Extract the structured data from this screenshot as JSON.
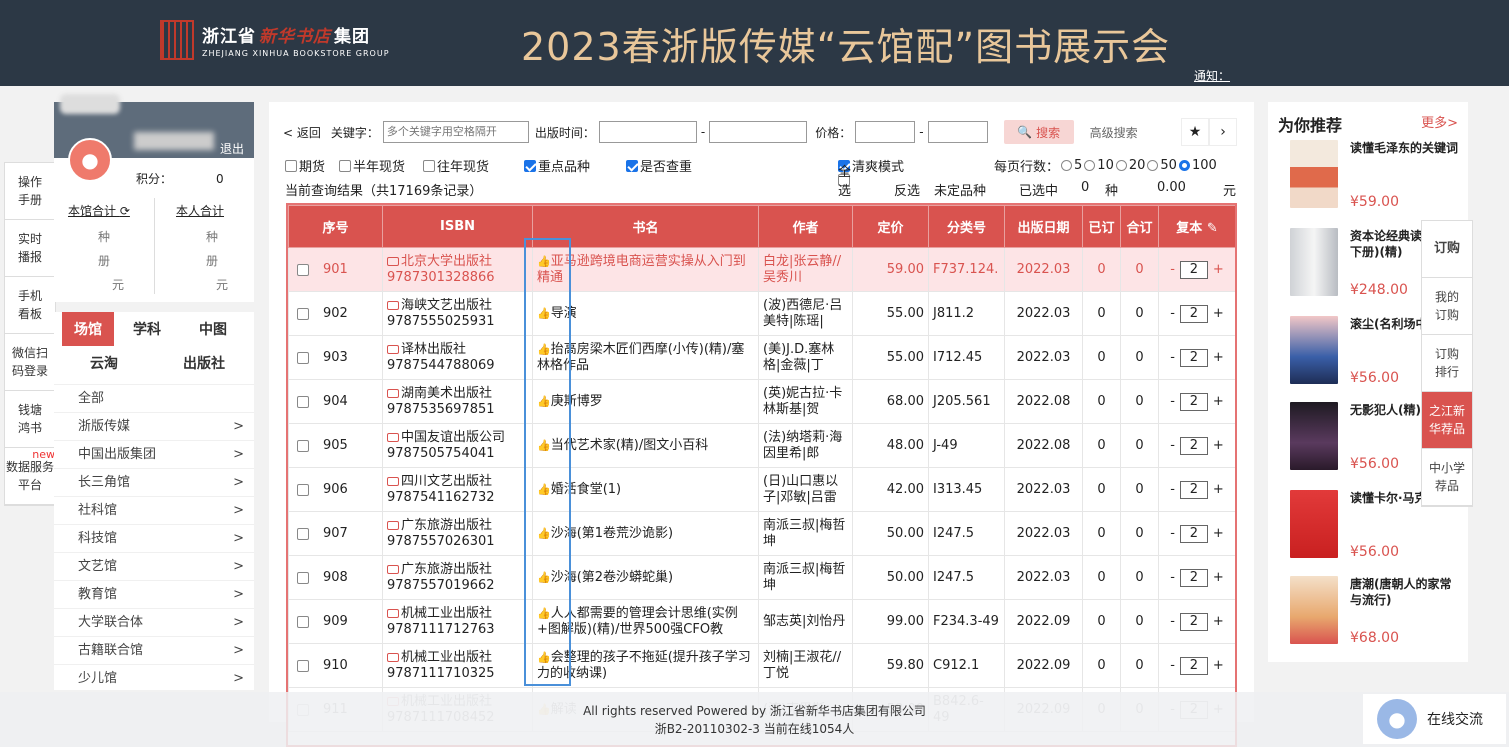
{
  "header": {
    "logo_cn_a": "浙江省",
    "logo_cn_b": "新华书店",
    "logo_cn_c": "集团",
    "logo_en": "ZHEJIANG XINHUA BOOKSTORE GROUP",
    "title": "2023春浙版传媒“云馆配”图书展示会",
    "notice": "通知："
  },
  "user": {
    "logout": "退出",
    "points_label": "积分：",
    "points_value": "0",
    "lib_total": "本馆合计",
    "my_total": "本人合计",
    "unit_kind": "种",
    "unit_book": "册",
    "unit_yuan": "元"
  },
  "sidetabs": [
    {
      "label": "操作手册"
    },
    {
      "label": "实时播报"
    },
    {
      "label": "手机看板"
    },
    {
      "label": "微信扫码登录"
    },
    {
      "label": "钱塘鸿书"
    },
    {
      "label": "数据服务平台",
      "badge": "new"
    }
  ],
  "cat": {
    "tabs": [
      "场馆",
      "学科",
      "中图",
      "云淘",
      "出版社"
    ],
    "items": [
      "全部",
      "浙版传媒",
      "中国出版集团",
      "长三角馆",
      "社科馆",
      "科技馆",
      "文艺馆",
      "教育馆",
      "大学联合体",
      "古籍联合馆",
      "少儿馆"
    ]
  },
  "filters": {
    "back": "< 返回",
    "keyword_label": "关键字：",
    "keyword_placeholder": "多个关键字用空格隔开",
    "date_label": "出版时间：",
    "dash": "-",
    "price_label": "价格：",
    "search": "搜索",
    "advanced": "高级搜索",
    "opts": [
      "期货",
      "半年现货",
      "往年现货",
      "重点品种",
      "是否查重",
      "清爽模式"
    ],
    "per_page_label": "每页行数：",
    "per_page": [
      "5",
      "10",
      "20",
      "50",
      "100"
    ],
    "result_text": "当前查询结果（共17169条记录）",
    "select_all": "全选",
    "invert": "反选",
    "unset": "未定品种",
    "selected_label": "已选中",
    "selected_value": "0",
    "kinds": "种",
    "amount": "0.00",
    "yuan": "元"
  },
  "table": {
    "headers": [
      "序号",
      "ISBN",
      "书名",
      "作者",
      "定价",
      "分类号",
      "出版日期",
      "已订",
      "合订",
      "复本"
    ],
    "rows": [
      {
        "no": "901",
        "pub": "北京大学出版社",
        "isbn": "9787301328866",
        "title": "亚马逊跨境电商运营实操从入门到精通",
        "author": "白龙|张云静//吴秀川",
        "price": "59.00",
        "cls": "F737.124.",
        "date": "2022.03",
        "ordered": "0",
        "combined": "0",
        "copies": "2"
      },
      {
        "no": "902",
        "pub": "海峡文艺出版社",
        "isbn": "9787555025931",
        "title": "导演",
        "author": "(波)西德尼·吕美特|陈瑶|",
        "price": "55.00",
        "cls": "J811.2",
        "date": "2022.03",
        "ordered": "0",
        "combined": "0",
        "copies": "2"
      },
      {
        "no": "903",
        "pub": "译林出版社",
        "isbn": "9787544788069",
        "title": "抬高房梁木匠们西摩(小传)(精)/塞林格作品",
        "author": "(美)J.D.塞林格|金薇|丁",
        "price": "55.00",
        "cls": "I712.45",
        "date": "2022.03",
        "ordered": "0",
        "combined": "0",
        "copies": "2"
      },
      {
        "no": "904",
        "pub": "湖南美术出版社",
        "isbn": "9787535697851",
        "title": "庚斯博罗",
        "author": "(英)妮古拉·卡林斯基|贺",
        "price": "68.00",
        "cls": "J205.561",
        "date": "2022.08",
        "ordered": "0",
        "combined": "0",
        "copies": "2"
      },
      {
        "no": "905",
        "pub": "中国友谊出版公司",
        "isbn": "9787505754041",
        "title": "当代艺术家(精)/图文小百科",
        "author": "(法)纳塔莉·海因里希|郎",
        "price": "48.00",
        "cls": "J-49",
        "date": "2022.08",
        "ordered": "0",
        "combined": "0",
        "copies": "2"
      },
      {
        "no": "906",
        "pub": "四川文艺出版社",
        "isbn": "9787541162732",
        "title": "婚活食堂(1)",
        "author": "(日)山口惠以子|邓敏|吕雷",
        "price": "42.00",
        "cls": "I313.45",
        "date": "2022.03",
        "ordered": "0",
        "combined": "0",
        "copies": "2"
      },
      {
        "no": "907",
        "pub": "广东旅游出版社",
        "isbn": "9787557026301",
        "title": "沙海(第1卷荒沙诡影)",
        "author": "南派三叔|梅哲坤",
        "price": "50.00",
        "cls": "I247.5",
        "date": "2022.03",
        "ordered": "0",
        "combined": "0",
        "copies": "2"
      },
      {
        "no": "908",
        "pub": "广东旅游出版社",
        "isbn": "9787557019662",
        "title": "沙海(第2卷沙蟒蛇巢)",
        "author": "南派三叔|梅哲坤",
        "price": "50.00",
        "cls": "I247.5",
        "date": "2022.03",
        "ordered": "0",
        "combined": "0",
        "copies": "2"
      },
      {
        "no": "909",
        "pub": "机械工业出版社",
        "isbn": "9787111712763",
        "title": "人人都需要的管理会计思维(实例+图解版)(精)/世界500强CFO教",
        "author": "邹志英|刘怡丹",
        "price": "99.00",
        "cls": "F234.3-49",
        "date": "2022.09",
        "ordered": "0",
        "combined": "0",
        "copies": "2"
      },
      {
        "no": "910",
        "pub": "机械工业出版社",
        "isbn": "9787111710325",
        "title": "会整理的孩子不拖延(提升孩子学习力的收纳课)",
        "author": "刘楠|王淑花//丁悦",
        "price": "59.80",
        "cls": "C912.1",
        "date": "2022.09",
        "ordered": "0",
        "combined": "0",
        "copies": "2"
      },
      {
        "no": "911",
        "pub": "机械工业出版社",
        "isbn": "9787111708452",
        "title": "解读",
        "author": "(澳)克里斯",
        "price": "58.00",
        "cls": "B842.6-49",
        "date": "2022.09",
        "ordered": "0",
        "combined": "0",
        "copies": "2"
      }
    ]
  },
  "footer": {
    "line1": "All rights reserved Powered by 浙江省新华书店集团有限公司",
    "line2": "浙B2-20110302-3    当前在线1054人"
  },
  "chat": {
    "label": "在线交流"
  },
  "recommend": {
    "title": "为你推荐",
    "more": "更多>",
    "items": [
      {
        "name": "读懂毛泽东的关键词",
        "price": "¥59.00"
      },
      {
        "name": "资本论经典读本(上下册)(精)",
        "price": "¥248.00"
      },
      {
        "name": "滚尘(名利场中人)",
        "price": "¥56.00"
      },
      {
        "name": "无影犯人(精)",
        "price": "¥56.00"
      },
      {
        "name": "读懂卡尔·马克思",
        "price": "¥56.00"
      },
      {
        "name": "唐潮(唐朝人的家常与流行)",
        "price": "¥68.00"
      }
    ]
  },
  "righttabs": [
    "订购",
    "我的订购",
    "订购排行",
    "之江新华荐品",
    "中小学荐品"
  ]
}
